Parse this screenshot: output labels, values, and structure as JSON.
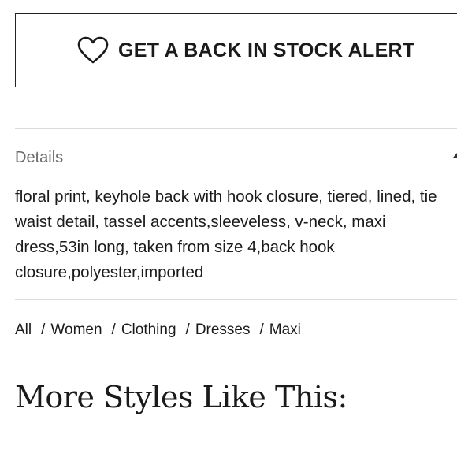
{
  "stock_alert": {
    "label": "GET A BACK IN STOCK ALERT",
    "icon": "heart-outline-icon"
  },
  "details": {
    "title": "Details",
    "toggle_icon": "caret-up-icon",
    "expanded": true,
    "description": "floral print, keyhole back with hook closure, tiered, lined, tie waist detail, tassel accents,sleeveless, v-neck, maxi dress,53in long, taken from size 4,back hook closure,polyester,imported"
  },
  "breadcrumb": {
    "items": [
      {
        "label": "All"
      },
      {
        "label": "Women"
      },
      {
        "label": "Clothing"
      },
      {
        "label": "Dresses"
      },
      {
        "label": "Maxi"
      }
    ],
    "separator": "/"
  },
  "more_styles": {
    "heading": "More Styles Like This:"
  },
  "colors": {
    "text": "#1a1a1a",
    "muted_text": "#6a6a6a",
    "border": "#222222",
    "divider": "#dcdcdc",
    "background": "#ffffff"
  }
}
